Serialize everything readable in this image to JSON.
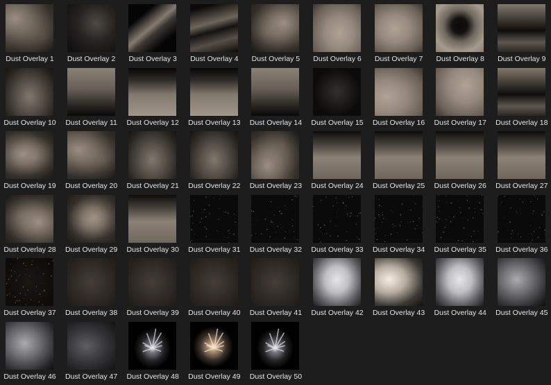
{
  "gallery": {
    "items": [
      {
        "label": "Dust Overlay 1",
        "style": "cloud-warm"
      },
      {
        "label": "Dust Overlay 2",
        "style": "haze-dark"
      },
      {
        "label": "Dust Overlay 3",
        "style": "wisp-diagonal"
      },
      {
        "label": "Dust Overlay 4",
        "style": "streak-dark"
      },
      {
        "label": "Dust Overlay 5",
        "style": "cloud-warm"
      },
      {
        "label": "Dust Overlay 6",
        "style": "cloud-light"
      },
      {
        "label": "Dust Overlay 7",
        "style": "cloud-light"
      },
      {
        "label": "Dust Overlay 8",
        "style": "ring-hole"
      },
      {
        "label": "Dust Overlay 9",
        "style": "band-dark"
      },
      {
        "label": "Dust Overlay 10",
        "style": "cloud-soft"
      },
      {
        "label": "Dust Overlay 11",
        "style": "cloud-dark-bottom"
      },
      {
        "label": "Dust Overlay 12",
        "style": "rising-bottom"
      },
      {
        "label": "Dust Overlay 13",
        "style": "rising-bottom"
      },
      {
        "label": "Dust Overlay 14",
        "style": "cloud-dark-bottom"
      },
      {
        "label": "Dust Overlay 15",
        "style": "faint-dark"
      },
      {
        "label": "Dust Overlay 16",
        "style": "cloud-light"
      },
      {
        "label": "Dust Overlay 17",
        "style": "cloud-light"
      },
      {
        "label": "Dust Overlay 18",
        "style": "band-dark"
      },
      {
        "label": "Dust Overlay 19",
        "style": "cloud-warm"
      },
      {
        "label": "Dust Overlay 20",
        "style": "cloud-warm"
      },
      {
        "label": "Dust Overlay 21",
        "style": "cloud-soft"
      },
      {
        "label": "Dust Overlay 22",
        "style": "cloud-soft"
      },
      {
        "label": "Dust Overlay 23",
        "style": "cloud-warm"
      },
      {
        "label": "Dust Overlay 24",
        "style": "cloud-dark-top"
      },
      {
        "label": "Dust Overlay 25",
        "style": "cloud-dark-top"
      },
      {
        "label": "Dust Overlay 26",
        "style": "cloud-dark-top"
      },
      {
        "label": "Dust Overlay 27",
        "style": "cloud-dark-top"
      },
      {
        "label": "Dust Overlay 28",
        "style": "cloud-warm"
      },
      {
        "label": "Dust Overlay 29",
        "style": "cloud-warm"
      },
      {
        "label": "Dust Overlay 30",
        "style": "cloud-dark-top"
      },
      {
        "label": "Dust Overlay 31",
        "style": "speckle"
      },
      {
        "label": "Dust Overlay 32",
        "style": "speckle"
      },
      {
        "label": "Dust Overlay 33",
        "style": "speckle"
      },
      {
        "label": "Dust Overlay 34",
        "style": "speckle"
      },
      {
        "label": "Dust Overlay 35",
        "style": "speckle"
      },
      {
        "label": "Dust Overlay 36",
        "style": "speckle"
      },
      {
        "label": "Dust Overlay 37",
        "style": "speckle-warm"
      },
      {
        "label": "Dust Overlay 38",
        "style": "murk"
      },
      {
        "label": "Dust Overlay 39",
        "style": "murk"
      },
      {
        "label": "Dust Overlay 40",
        "style": "murk"
      },
      {
        "label": "Dust Overlay 41",
        "style": "murk"
      },
      {
        "label": "Dust Overlay 42",
        "style": "smoke-white"
      },
      {
        "label": "Dust Overlay 43",
        "style": "smoke-bright"
      },
      {
        "label": "Dust Overlay 44",
        "style": "smoke-white"
      },
      {
        "label": "Dust Overlay 45",
        "style": "smoke-grey"
      },
      {
        "label": "Dust Overlay 46",
        "style": "smoke-grey"
      },
      {
        "label": "Dust Overlay 47",
        "style": "smoke-dim"
      },
      {
        "label": "Dust Overlay 48",
        "style": "burst-white"
      },
      {
        "label": "Dust Overlay 49",
        "style": "burst-warm"
      },
      {
        "label": "Dust Overlay 50",
        "style": "burst-white"
      }
    ]
  },
  "colors": {
    "page_background": "#1d1d1d",
    "label_text": "#e6e6e6",
    "dust_warm": "#8f8478",
    "dust_light": "#a89c8e",
    "smoke_white": "#d8d8d8"
  }
}
